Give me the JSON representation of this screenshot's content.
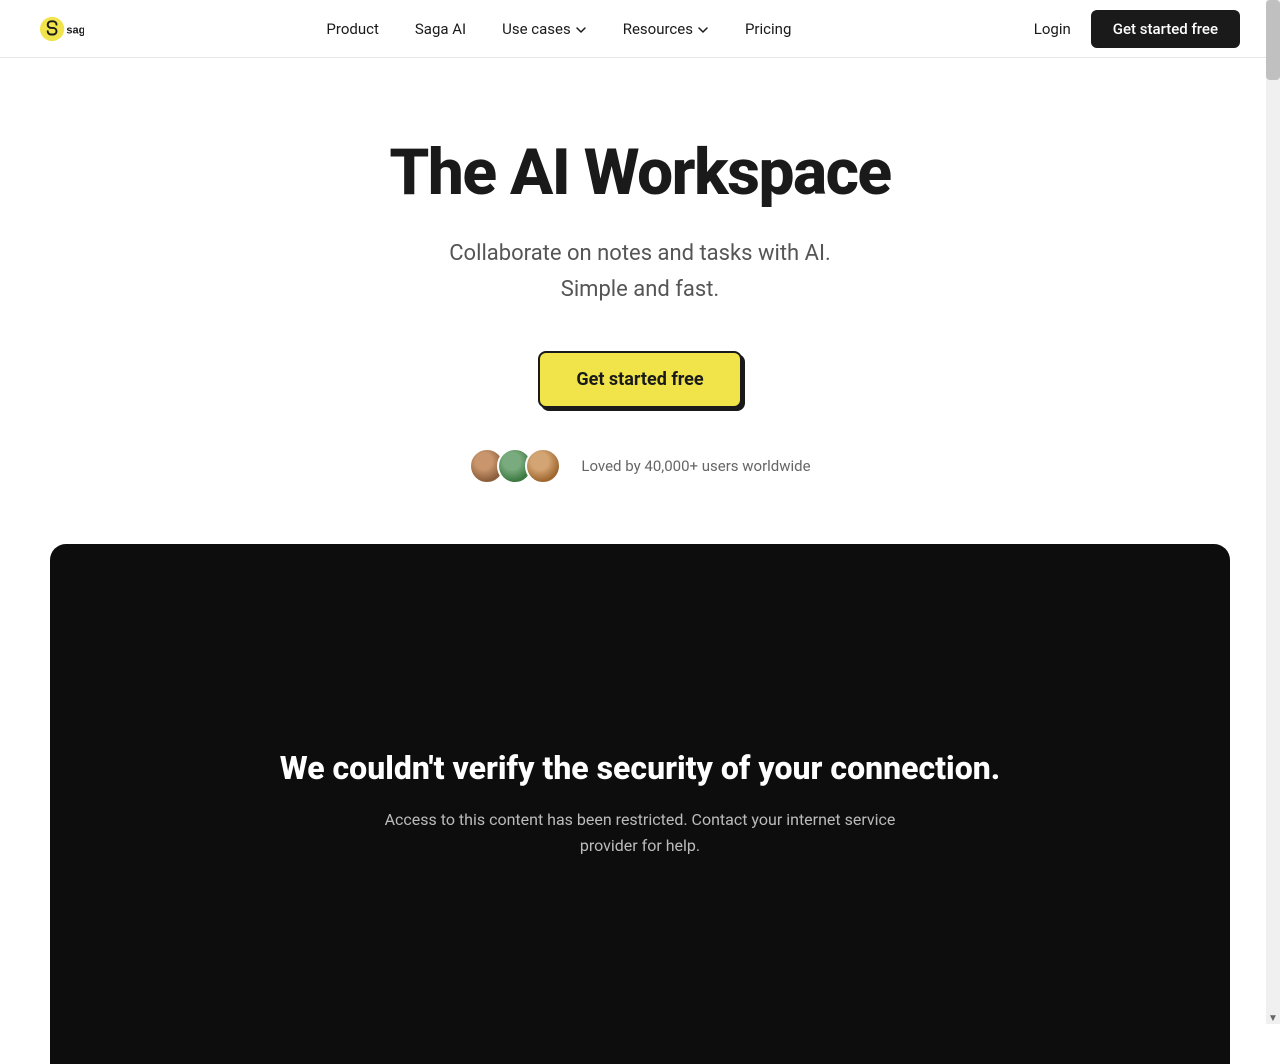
{
  "brand": {
    "name": "saga",
    "logo_alt": "Saga logo"
  },
  "nav": {
    "links": [
      {
        "label": "Product",
        "has_dropdown": false
      },
      {
        "label": "Saga AI",
        "has_dropdown": false
      },
      {
        "label": "Use cases",
        "has_dropdown": true
      },
      {
        "label": "Resources",
        "has_dropdown": true
      },
      {
        "label": "Pricing",
        "has_dropdown": false
      }
    ],
    "login_label": "Login",
    "cta_label": "Get started free"
  },
  "hero": {
    "title": "The AI Workspace",
    "subtitle_line1": "Collaborate on notes and tasks with AI.",
    "subtitle_line2": "Simple and fast.",
    "cta_label": "Get started free",
    "social_proof_text": "Loved by 40,000+ users worldwide",
    "avatars": [
      {
        "label": "User 1",
        "color": "#8B5E3C"
      },
      {
        "label": "User 2",
        "color": "#5B7E5E"
      },
      {
        "label": "User 3",
        "color": "#C49A6C"
      }
    ]
  },
  "dark_section": {
    "warning_title": "We couldn't verify the security of your connection.",
    "warning_text": "Access to this content has been restricted. Contact your internet service provider for help."
  },
  "scrollbar": {
    "up_arrow": "▲",
    "down_arrow": "▼"
  }
}
